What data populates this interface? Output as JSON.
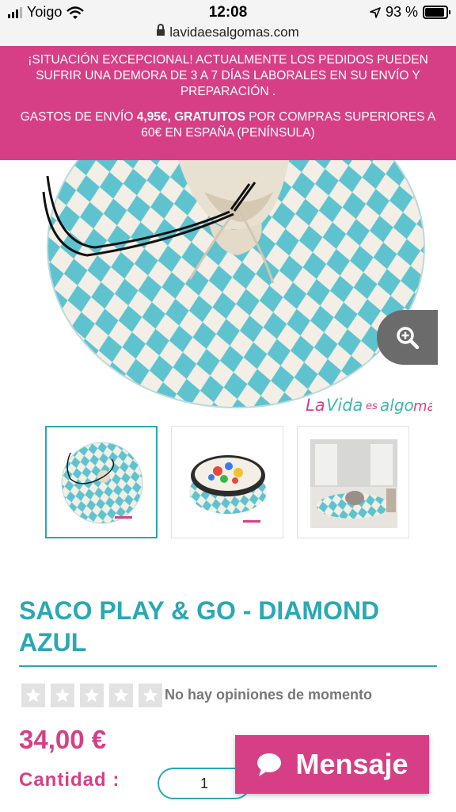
{
  "status_bar": {
    "carrier": "Yoigo",
    "time": "12:08",
    "battery": "93 %"
  },
  "browser": {
    "url": "lavidaesalgomas.com"
  },
  "banner": {
    "notice": "¡SITUACIÓN EXCEPCIONAL! ACTUALMENTE LOS PEDIDOS PUEDEN SUFRIR UNA DEMORA DE 3 A 7 DÍAS LABORALES EN SU ENVÍO Y PREPARACIÓN .",
    "shipping_prefix": "GASTOS DE ENVÍO ",
    "shipping_cost": "4,95€, GRATUITOS",
    "shipping_suffix": " POR COMPRAS SUPERIORES A 60€ EN ESPAÑA (PENÍNSULA)"
  },
  "gallery": {
    "brand_logo_text": "LaVidaesalgomás",
    "zoom_icon": "zoom-in-icon"
  },
  "product": {
    "title": "SACO PLAY & GO - DIAMOND AZUL",
    "reviews_text": "No hay opiniones de momento",
    "rating": 0,
    "rating_max": 5,
    "price": "34,00 €",
    "quantity_label": "Cantidad :",
    "quantity_value": "1"
  },
  "chat": {
    "label": "Mensaje",
    "icon": "chat-bubble-icon"
  },
  "colors": {
    "brand_pink": "#d63f86",
    "brand_teal": "#2aa8b3"
  }
}
